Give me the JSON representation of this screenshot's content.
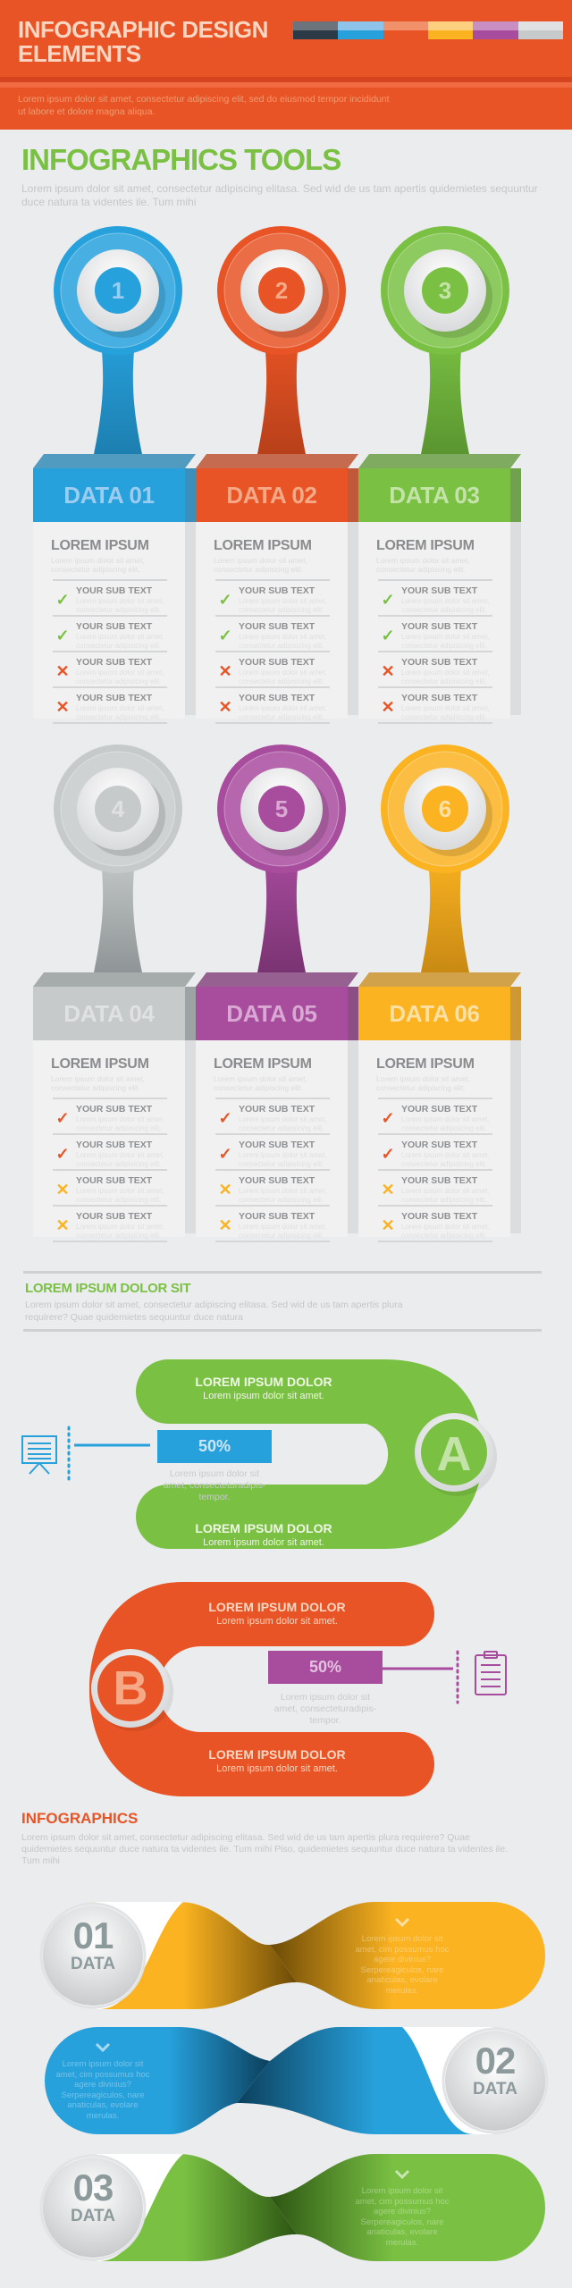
{
  "header": {
    "title_line1": "INFOGRAPHIC DESIGN",
    "title_line2": "ELEMENTS",
    "description": "Lorem ipsum dolor sit amet, consectetur adipiscing elit, sed do eiusmod tempor incididunt ut labore et dolore magna aliqua.",
    "swatches": [
      {
        "light": "#6c737b",
        "dark": "#2c3a47"
      },
      {
        "light": "#8ec3ea",
        "dark": "#27a1dc"
      },
      {
        "light": "#f1916c",
        "dark": "#e85425"
      },
      {
        "light": "#fdd07f",
        "dark": "#fbb321"
      },
      {
        "light": "#c98fc2",
        "dark": "#a84c9e"
      },
      {
        "light": "#dfe1e2",
        "dark": "#c6cacb"
      }
    ]
  },
  "tools": {
    "title": "INFOGRAPHICS TOOLS",
    "description": "Lorem ipsum dolor sit amet, consectetur adipiscing elitasa. Sed wid de us tam apertis quidemietes sequuntur duce natura ta videntes ile. Tum mihi",
    "cards": [
      {
        "number": "1",
        "label": "DATA 01",
        "color": "#27a1dc",
        "dark": "#1d7fb0",
        "text_color": "#9ccdf0",
        "heading": "LOREM IPSUM",
        "sub": "Lorem ipsum dolor sit amet, consectetur adipiscing elit.",
        "items": [
          {
            "title": "YOUR SUB TEXT",
            "desc": "Lorem ipsum dolor sit amet, consectetur adipisicing elit.",
            "status": "check",
            "status_color": "#7ac143"
          },
          {
            "title": "YOUR SUB TEXT",
            "desc": "Lorem ipsum dolor sit amet, consectetur adipisicing elit.",
            "status": "check",
            "status_color": "#7ac143"
          },
          {
            "title": "YOUR SUB TEXT",
            "desc": "Lorem ipsum dolor sit amet, consectetur adipisicing elit.",
            "status": "cross",
            "status_color": "#e85425"
          },
          {
            "title": "YOUR SUB TEXT",
            "desc": "Lorem ipsum dolor sit amet, consectetur adipisicing elit.",
            "status": "cross",
            "status_color": "#e85425"
          }
        ]
      },
      {
        "number": "2",
        "label": "DATA 02",
        "color": "#e85425",
        "dark": "#b8401a",
        "text_color": "#f6a986",
        "heading": "LOREM IPSUM",
        "sub": "Lorem ipsum dolor sit amet, consectetur adipiscing elit.",
        "items": [
          {
            "title": "YOUR SUB TEXT",
            "desc": "Lorem ipsum dolor sit amet, consectetur adipisicing elit.",
            "status": "check",
            "status_color": "#7ac143"
          },
          {
            "title": "YOUR SUB TEXT",
            "desc": "Lorem ipsum dolor sit amet, consectetur adipisicing elit.",
            "status": "check",
            "status_color": "#7ac143"
          },
          {
            "title": "YOUR SUB TEXT",
            "desc": "Lorem ipsum dolor sit amet, consectetur adipisicing elit.",
            "status": "cross",
            "status_color": "#e85425"
          },
          {
            "title": "YOUR SUB TEXT",
            "desc": "Lorem ipsum dolor sit amet, consectetur adipisicing elit.",
            "status": "cross",
            "status_color": "#e85425"
          }
        ]
      },
      {
        "number": "3",
        "label": "DATA 03",
        "color": "#7ac143",
        "dark": "#5a9530",
        "text_color": "#c4e3a8",
        "heading": "LOREM IPSUM",
        "sub": "Lorem ipsum dolor sit amet, consectetur adipiscing elit.",
        "items": [
          {
            "title": "YOUR SUB TEXT",
            "desc": "Lorem ipsum dolor sit amet, consectetur adipisicing elit.",
            "status": "check",
            "status_color": "#7ac143"
          },
          {
            "title": "YOUR SUB TEXT",
            "desc": "Lorem ipsum dolor sit amet, consectetur adipisicing elit.",
            "status": "check",
            "status_color": "#7ac143"
          },
          {
            "title": "YOUR SUB TEXT",
            "desc": "Lorem ipsum dolor sit amet, consectetur adipisicing elit.",
            "status": "cross",
            "status_color": "#e85425"
          },
          {
            "title": "YOUR SUB TEXT",
            "desc": "Lorem ipsum dolor sit amet, consectetur adipisicing elit.",
            "status": "cross",
            "status_color": "#e85425"
          }
        ]
      },
      {
        "number": "4",
        "label": "DATA 04",
        "color": "#c6cacb",
        "dark": "#8f9596",
        "text_color": "#dfe1e2",
        "heading": "LOREM IPSUM",
        "sub": "Lorem ipsum dolor sit amet, consectetur adipiscing elit.",
        "items": [
          {
            "title": "YOUR SUB TEXT",
            "desc": "Lorem ipsum dolor sit amet, consectetur adipisicing elit.",
            "status": "check",
            "status_color": "#e85425"
          },
          {
            "title": "YOUR SUB TEXT",
            "desc": "Lorem ipsum dolor sit amet, consectetur adipisicing elit.",
            "status": "check",
            "status_color": "#e85425"
          },
          {
            "title": "YOUR SUB TEXT",
            "desc": "Lorem ipsum dolor sit amet, consectetur adipisicing elit.",
            "status": "cross",
            "status_color": "#fbb321"
          },
          {
            "title": "YOUR SUB TEXT",
            "desc": "Lorem ipsum dolor sit amet, consectetur adipisicing elit.",
            "status": "cross",
            "status_color": "#fbb321"
          }
        ]
      },
      {
        "number": "5",
        "label": "DATA 05",
        "color": "#a84c9e",
        "dark": "#7a3372",
        "text_color": "#d9a9d3",
        "heading": "LOREM IPSUM",
        "sub": "Lorem ipsum dolor sit amet, consectetur adipiscing elit.",
        "items": [
          {
            "title": "YOUR SUB TEXT",
            "desc": "Lorem ipsum dolor sit amet, consectetur adipisicing elit.",
            "status": "check",
            "status_color": "#e85425"
          },
          {
            "title": "YOUR SUB TEXT",
            "desc": "Lorem ipsum dolor sit amet, consectetur adipisicing elit.",
            "status": "check",
            "status_color": "#e85425"
          },
          {
            "title": "YOUR SUB TEXT",
            "desc": "Lorem ipsum dolor sit amet, consectetur adipisicing elit.",
            "status": "cross",
            "status_color": "#fbb321"
          },
          {
            "title": "YOUR SUB TEXT",
            "desc": "Lorem ipsum dolor sit amet, consectetur adipisicing elit.",
            "status": "cross",
            "status_color": "#fbb321"
          }
        ]
      },
      {
        "number": "6",
        "label": "DATA 06",
        "color": "#fbb321",
        "dark": "#c98a14",
        "text_color": "#fde0a3",
        "heading": "LOREM IPSUM",
        "sub": "Lorem ipsum dolor sit amet, consectetur adipiscing elit.",
        "items": [
          {
            "title": "YOUR SUB TEXT",
            "desc": "Lorem ipsum dolor sit amet, consectetur adipisicing elit.",
            "status": "check",
            "status_color": "#e85425"
          },
          {
            "title": "YOUR SUB TEXT",
            "desc": "Lorem ipsum dolor sit amet, consectetur adipisicing elit.",
            "status": "check",
            "status_color": "#e85425"
          },
          {
            "title": "YOUR SUB TEXT",
            "desc": "Lorem ipsum dolor sit amet, consectetur adipisicing elit.",
            "status": "cross",
            "status_color": "#fbb321"
          },
          {
            "title": "YOUR SUB TEXT",
            "desc": "Lorem ipsum dolor sit amet, consectetur adipisicing elit.",
            "status": "cross",
            "status_color": "#fbb321"
          }
        ]
      }
    ]
  },
  "ipsum_section": {
    "title": "LOREM IPSUM DOLOR SIT",
    "description": "Lorem ipsum dolor sit amet, consectetur adipiscing elitasa. Sed wid de us tam apertis plura requirere? Quae quidemietes sequuntur duce natura"
  },
  "process": {
    "a": {
      "letter": "A",
      "color": "#7ac143",
      "top": {
        "title": "LOREM IPSUM DOLOR",
        "desc": "Lorem ipsum dolor sit amet."
      },
      "bottom": {
        "title": "LOREM IPSUM DOLOR",
        "desc": "Lorem ipsum dolor sit amet."
      },
      "percent": "50%",
      "percent_color": "#27a1dc",
      "percent_desc": "Lorem ipsum dolor sit amet, consecteturadipis-tempor.",
      "icon": "presentation-board-icon"
    },
    "b": {
      "letter": "B",
      "color": "#e85425",
      "top": {
        "title": "LOREM IPSUM DOLOR",
        "desc": "Lorem ipsum dolor sit amet."
      },
      "bottom": {
        "title": "LOREM IPSUM DOLOR",
        "desc": "Lorem ipsum dolor sit amet."
      },
      "percent": "50%",
      "percent_color": "#a84c9e",
      "percent_desc": "Lorem ipsum dolor sit amet, consecteturadipis-tempor.",
      "icon": "clipboard-icon"
    }
  },
  "infographics": {
    "title": "INFOGRAPHICS",
    "description": "Lorem ipsum dolor sit amet, consectetur adipiscing elitasa. Sed wid de us tam apertis plura requirere? Quae quidemietes sequuntur duce natura ta videntes ile. Tum mihi Piso, quidemietes sequuntur duce natura ta videntes ile. Tum mihi",
    "ribbons": [
      {
        "number": "01",
        "label": "DATA",
        "color": "#fbb321",
        "dark": "#6b4a06",
        "side": "left",
        "text": "Lorem ipsum dolor sit amet, cim possumus hoc agere divinius?Serpereagiculos, nare anaticulas, evolare merulas."
      },
      {
        "number": "02",
        "label": "DATA",
        "color": "#27a1dc",
        "dark": "#0b3f5c",
        "side": "right",
        "text": "Lorem ipsum dolor sit amet, cim possumus hoc agere divinius?Serpereagiculos, nare anaticulas, evolare merulas."
      },
      {
        "number": "03",
        "label": "DATA",
        "color": "#7ac143",
        "dark": "#2c5512",
        "side": "left",
        "text": "Lorem ipsum dolor sit amet, cim possumus hoc agere divinius?Serpereagiculos, nare anaticulas, evolare merulas."
      }
    ]
  }
}
